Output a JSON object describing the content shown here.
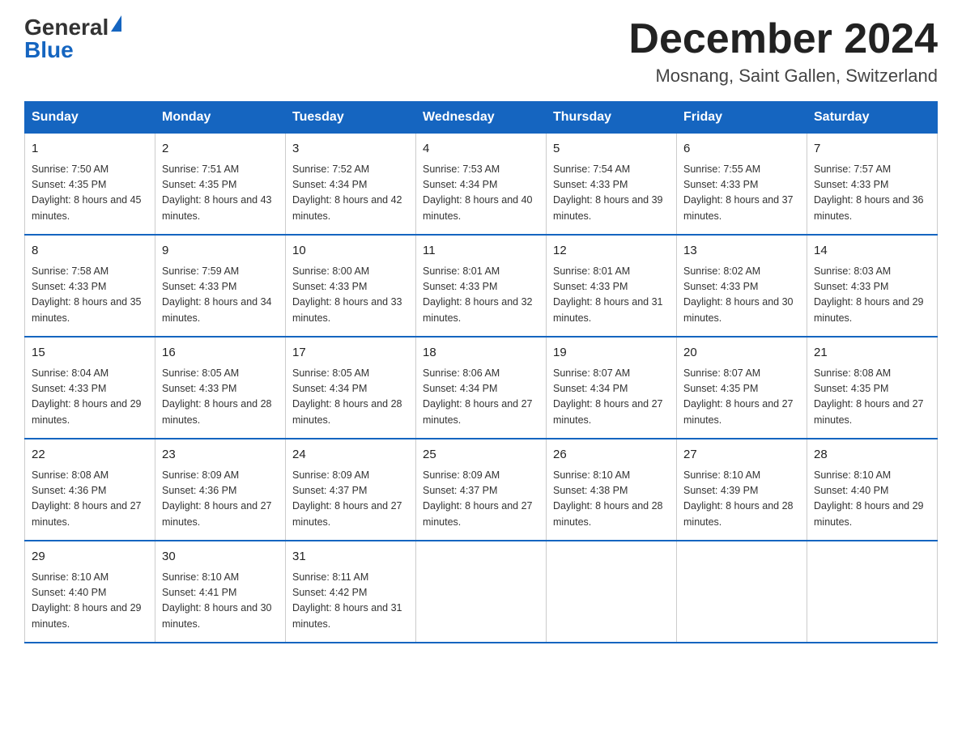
{
  "header": {
    "logo_general": "General",
    "logo_blue": "Blue",
    "month_title": "December 2024",
    "location": "Mosnang, Saint Gallen, Switzerland"
  },
  "days_of_week": [
    "Sunday",
    "Monday",
    "Tuesday",
    "Wednesday",
    "Thursday",
    "Friday",
    "Saturday"
  ],
  "weeks": [
    [
      {
        "day": "1",
        "sunrise": "7:50 AM",
        "sunset": "4:35 PM",
        "daylight": "8 hours and 45 minutes."
      },
      {
        "day": "2",
        "sunrise": "7:51 AM",
        "sunset": "4:35 PM",
        "daylight": "8 hours and 43 minutes."
      },
      {
        "day": "3",
        "sunrise": "7:52 AM",
        "sunset": "4:34 PM",
        "daylight": "8 hours and 42 minutes."
      },
      {
        "day": "4",
        "sunrise": "7:53 AM",
        "sunset": "4:34 PM",
        "daylight": "8 hours and 40 minutes."
      },
      {
        "day": "5",
        "sunrise": "7:54 AM",
        "sunset": "4:33 PM",
        "daylight": "8 hours and 39 minutes."
      },
      {
        "day": "6",
        "sunrise": "7:55 AM",
        "sunset": "4:33 PM",
        "daylight": "8 hours and 37 minutes."
      },
      {
        "day": "7",
        "sunrise": "7:57 AM",
        "sunset": "4:33 PM",
        "daylight": "8 hours and 36 minutes."
      }
    ],
    [
      {
        "day": "8",
        "sunrise": "7:58 AM",
        "sunset": "4:33 PM",
        "daylight": "8 hours and 35 minutes."
      },
      {
        "day": "9",
        "sunrise": "7:59 AM",
        "sunset": "4:33 PM",
        "daylight": "8 hours and 34 minutes."
      },
      {
        "day": "10",
        "sunrise": "8:00 AM",
        "sunset": "4:33 PM",
        "daylight": "8 hours and 33 minutes."
      },
      {
        "day": "11",
        "sunrise": "8:01 AM",
        "sunset": "4:33 PM",
        "daylight": "8 hours and 32 minutes."
      },
      {
        "day": "12",
        "sunrise": "8:01 AM",
        "sunset": "4:33 PM",
        "daylight": "8 hours and 31 minutes."
      },
      {
        "day": "13",
        "sunrise": "8:02 AM",
        "sunset": "4:33 PM",
        "daylight": "8 hours and 30 minutes."
      },
      {
        "day": "14",
        "sunrise": "8:03 AM",
        "sunset": "4:33 PM",
        "daylight": "8 hours and 29 minutes."
      }
    ],
    [
      {
        "day": "15",
        "sunrise": "8:04 AM",
        "sunset": "4:33 PM",
        "daylight": "8 hours and 29 minutes."
      },
      {
        "day": "16",
        "sunrise": "8:05 AM",
        "sunset": "4:33 PM",
        "daylight": "8 hours and 28 minutes."
      },
      {
        "day": "17",
        "sunrise": "8:05 AM",
        "sunset": "4:34 PM",
        "daylight": "8 hours and 28 minutes."
      },
      {
        "day": "18",
        "sunrise": "8:06 AM",
        "sunset": "4:34 PM",
        "daylight": "8 hours and 27 minutes."
      },
      {
        "day": "19",
        "sunrise": "8:07 AM",
        "sunset": "4:34 PM",
        "daylight": "8 hours and 27 minutes."
      },
      {
        "day": "20",
        "sunrise": "8:07 AM",
        "sunset": "4:35 PM",
        "daylight": "8 hours and 27 minutes."
      },
      {
        "day": "21",
        "sunrise": "8:08 AM",
        "sunset": "4:35 PM",
        "daylight": "8 hours and 27 minutes."
      }
    ],
    [
      {
        "day": "22",
        "sunrise": "8:08 AM",
        "sunset": "4:36 PM",
        "daylight": "8 hours and 27 minutes."
      },
      {
        "day": "23",
        "sunrise": "8:09 AM",
        "sunset": "4:36 PM",
        "daylight": "8 hours and 27 minutes."
      },
      {
        "day": "24",
        "sunrise": "8:09 AM",
        "sunset": "4:37 PM",
        "daylight": "8 hours and 27 minutes."
      },
      {
        "day": "25",
        "sunrise": "8:09 AM",
        "sunset": "4:37 PM",
        "daylight": "8 hours and 27 minutes."
      },
      {
        "day": "26",
        "sunrise": "8:10 AM",
        "sunset": "4:38 PM",
        "daylight": "8 hours and 28 minutes."
      },
      {
        "day": "27",
        "sunrise": "8:10 AM",
        "sunset": "4:39 PM",
        "daylight": "8 hours and 28 minutes."
      },
      {
        "day": "28",
        "sunrise": "8:10 AM",
        "sunset": "4:40 PM",
        "daylight": "8 hours and 29 minutes."
      }
    ],
    [
      {
        "day": "29",
        "sunrise": "8:10 AM",
        "sunset": "4:40 PM",
        "daylight": "8 hours and 29 minutes."
      },
      {
        "day": "30",
        "sunrise": "8:10 AM",
        "sunset": "4:41 PM",
        "daylight": "8 hours and 30 minutes."
      },
      {
        "day": "31",
        "sunrise": "8:11 AM",
        "sunset": "4:42 PM",
        "daylight": "8 hours and 31 minutes."
      },
      null,
      null,
      null,
      null
    ]
  ]
}
